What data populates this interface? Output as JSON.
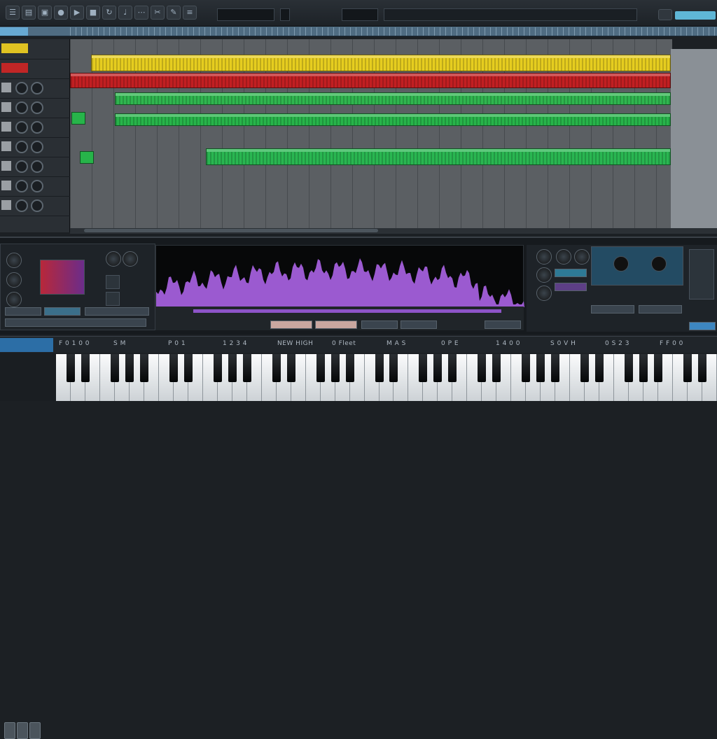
{
  "window": {
    "title": ""
  },
  "toolbar": {
    "buttons": [
      "menu-icon",
      "folder-icon",
      "save-icon",
      "record-icon",
      "play-icon",
      "stop-icon",
      "loop-icon",
      "metronome-icon",
      "snap-icon",
      "cut-icon",
      "pencil-icon",
      "mixer-icon"
    ],
    "accent_color": "#5fb6d6"
  },
  "tracks": [
    {
      "name": "",
      "color": "#e0c322",
      "clip_color": "#e6cd1f"
    },
    {
      "name": "",
      "color": "#c12626",
      "clip_color": "#c21f22"
    },
    {
      "name": "",
      "color": "#9a9fa4",
      "clip_color": "#2fb64f"
    },
    {
      "name": "",
      "color": "#2aa84a",
      "clip_color": "#27b44a"
    },
    {
      "name": "",
      "color": "#9a9fa4",
      "clip_color": ""
    },
    {
      "name": "",
      "color": "#2aa84a",
      "clip_color": "#29b651"
    }
  ],
  "editor": {
    "waveform_color": "#9b5ad0",
    "lane_color": "#8d54c8"
  },
  "keyboard": {
    "labels": [
      "F 0 1 0 0",
      "S M",
      "P 0 1",
      "1 2 3 4",
      "NEW HIGH",
      "0 Fleet",
      "M A S",
      "0 P E",
      "1 4 0 0",
      "S 0 V H",
      "0 S 2 3",
      "F F 0 0"
    ],
    "white_key_count": 45
  },
  "colors": {
    "background": "#1c2024",
    "ruler": "#4f6c82",
    "arrange": "#5b5f63"
  }
}
